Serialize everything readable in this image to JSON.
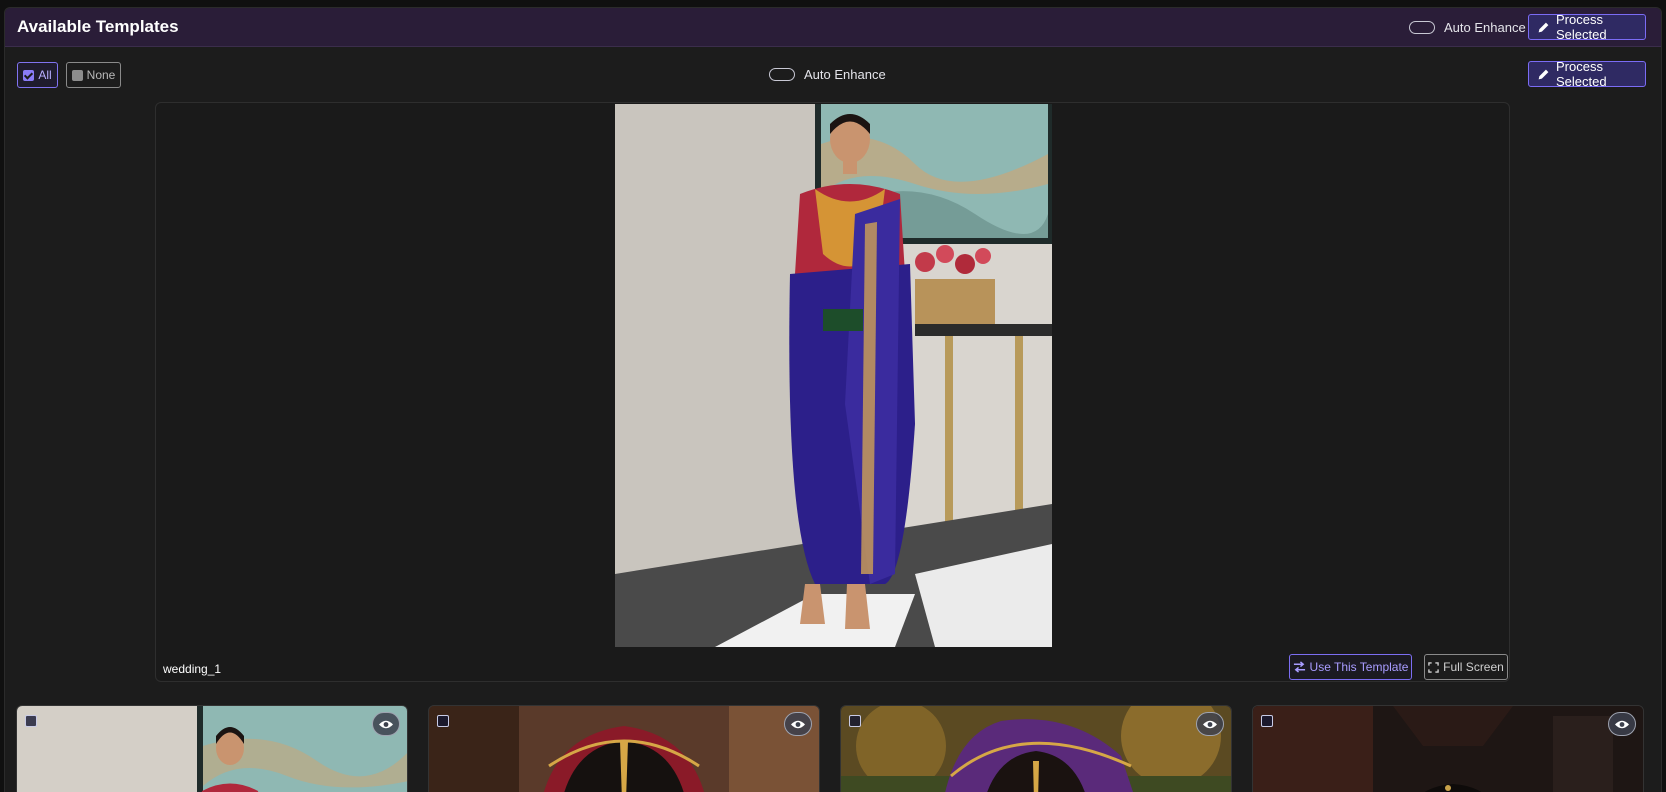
{
  "header": {
    "title": "Available Templates",
    "auto_enhance_label": "Auto Enhance",
    "process_selected_label": "Process Selected"
  },
  "toolbar": {
    "all_label": "All",
    "none_label": "None",
    "auto_enhance_label": "Auto Enhance",
    "process_selected_label": "Process Selected"
  },
  "preview": {
    "name": "wedding_1",
    "use_template_label": "Use This Template",
    "full_screen_label": "Full Screen"
  },
  "thumbnails": [
    {
      "selected": false
    },
    {
      "selected": false
    },
    {
      "selected": false
    },
    {
      "selected": false
    }
  ],
  "colors": {
    "accent": "#7b6cf5",
    "header_bg": "#2a1d38",
    "panel_bg": "#1c1c1c"
  },
  "icons": [
    "pencil-icon",
    "checkbox-checked-icon",
    "checkbox-empty-icon",
    "swap-icon",
    "fullscreen-icon",
    "eye-icon"
  ]
}
